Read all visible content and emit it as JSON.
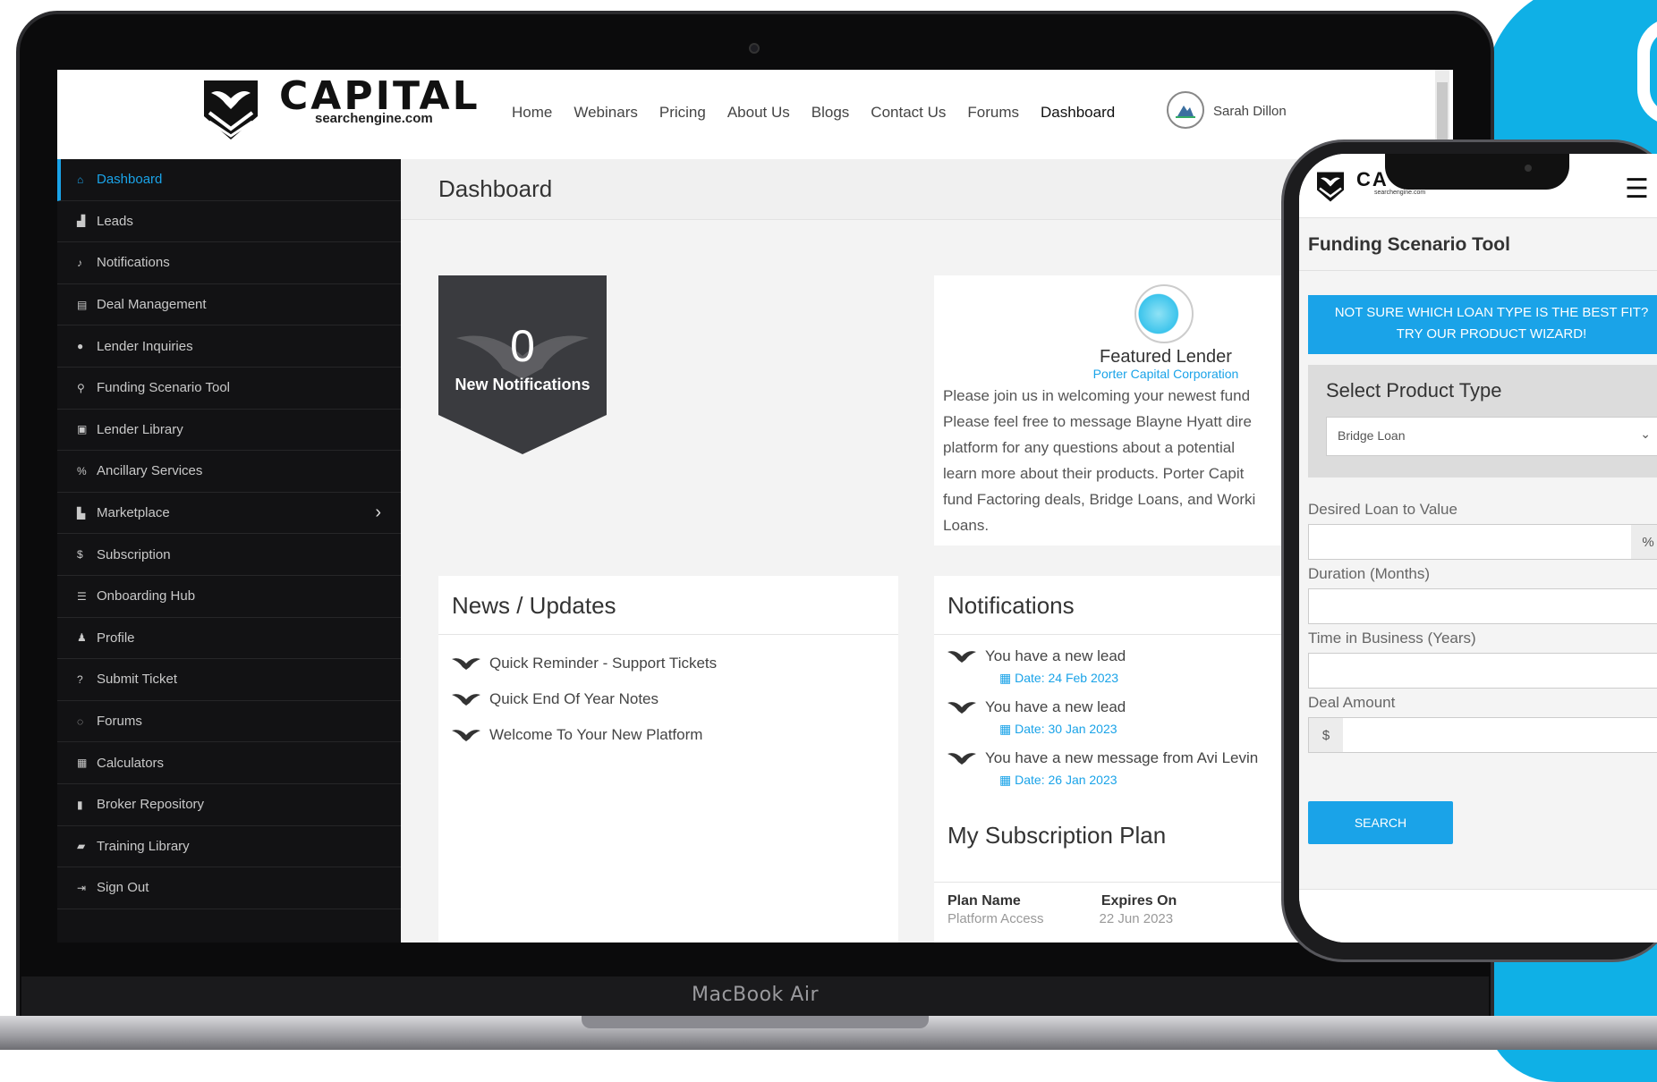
{
  "brand": {
    "name": "CAPITAL",
    "domain": "searchengine.com"
  },
  "nav": {
    "links": [
      "Home",
      "Webinars",
      "Pricing",
      "About Us",
      "Blogs",
      "Contact Us",
      "Forums",
      "Dashboard"
    ],
    "user": "Sarah Dillon"
  },
  "sidebar": {
    "items": [
      {
        "label": "Dashboard",
        "icon": "home-icon",
        "glyph": "⌂"
      },
      {
        "label": "Leads",
        "icon": "bar-chart-icon",
        "glyph": "▟"
      },
      {
        "label": "Notifications",
        "icon": "bell-icon",
        "glyph": "♪"
      },
      {
        "label": "Deal Management",
        "icon": "database-icon",
        "glyph": "▤"
      },
      {
        "label": "Lender Inquiries",
        "icon": "comments-icon",
        "glyph": "●"
      },
      {
        "label": "Funding Scenario Tool",
        "icon": "search-icon",
        "glyph": "⚲"
      },
      {
        "label": "Lender Library",
        "icon": "book-icon",
        "glyph": "▣"
      },
      {
        "label": "Ancillary Services",
        "icon": "percent-icon",
        "glyph": "%"
      },
      {
        "label": "Marketplace",
        "icon": "chart-icon",
        "glyph": "▙"
      },
      {
        "label": "Subscription",
        "icon": "dollar-icon",
        "glyph": "$"
      },
      {
        "label": "Onboarding Hub",
        "icon": "list-icon",
        "glyph": "☰"
      },
      {
        "label": "Profile",
        "icon": "user-icon",
        "glyph": "♟"
      },
      {
        "label": "Submit Ticket",
        "icon": "question-icon",
        "glyph": "?"
      },
      {
        "label": "Forums",
        "icon": "comment-icon",
        "glyph": "◌"
      },
      {
        "label": "Calculators",
        "icon": "calculator-icon",
        "glyph": "▦"
      },
      {
        "label": "Broker Repository",
        "icon": "bookmark-icon",
        "glyph": "▮"
      },
      {
        "label": "Training Library",
        "icon": "book-open-icon",
        "glyph": "▰"
      },
      {
        "label": "Sign Out",
        "icon": "sign-out-icon",
        "glyph": "⇥"
      }
    ]
  },
  "main": {
    "title": "Dashboard",
    "notifications_badge": {
      "count": "0",
      "label": "New Notifications"
    },
    "featured": {
      "title": "Featured Lender",
      "lender": "Porter Capital Corporation",
      "body_lines": [
        "Please join us in welcoming your newest fund",
        "Please feel free to message Blayne Hyatt dire",
        "platform for any questions about a potential",
        "learn more about their products. Porter Capit",
        "fund Factoring deals, Bridge Loans, and Worki",
        "Loans."
      ]
    },
    "news": {
      "title": "News / Updates",
      "items": [
        "Quick Reminder - Support Tickets",
        "Quick End Of Year Notes",
        "Welcome To Your New Platform"
      ]
    },
    "notifications": {
      "title": "Notifications",
      "items": [
        {
          "text": "You have a new lead",
          "date": "Date: 24 Feb 2023"
        },
        {
          "text": "You have a new lead",
          "date": "Date: 30 Jan 2023"
        },
        {
          "text": "You have a new message from Avi Levin",
          "date": "Date: 26 Jan 2023"
        }
      ]
    },
    "subscription": {
      "title": "My Subscription Plan",
      "col_plan": "Plan Name",
      "col_expires": "Expires On",
      "plan_value": "Platform Access",
      "expires_value": "22 Jun 2023"
    }
  },
  "device_label": "MacBook Air",
  "phone": {
    "brand": "CA",
    "brand_sub": "searchengine.com",
    "title": "Funding Scenario Tool",
    "wizard_line1": "NOT SURE WHICH LOAN TYPE IS THE BEST FIT?",
    "wizard_line2": "TRY OUR PRODUCT WIZARD!",
    "select_label": "Select Product Type",
    "select_value": "Bridge Loan",
    "fields": {
      "ltv": "Desired Loan to Value",
      "ltv_suffix": "%",
      "duration": "Duration (Months)",
      "time_in_business": "Time in Business (Years)",
      "deal_amount": "Deal Amount",
      "deal_prefix": "$"
    },
    "search_label": "SEARCH"
  },
  "colors": {
    "accent": "#1aa3e8",
    "sidebar_bg": "#121214",
    "badge_bg": "#3a3b3f",
    "deco_blue": "#0fb0e6"
  }
}
